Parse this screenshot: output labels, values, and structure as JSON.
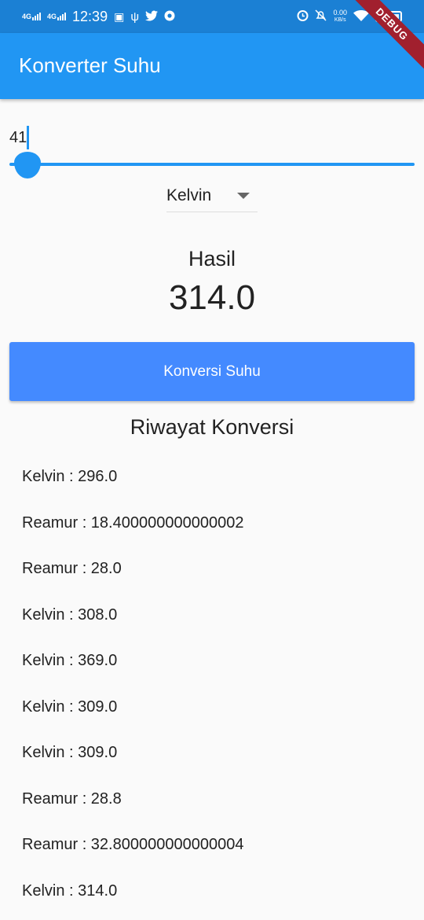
{
  "status_bar": {
    "network": "4G",
    "network2": "4G",
    "time": "12:39",
    "speed_value": "0.00",
    "speed_unit": "KB/s"
  },
  "app_bar": {
    "title": "Konverter Suhu",
    "debug_banner": "DEBUG"
  },
  "slider": {
    "value_label": "41",
    "value": 41,
    "level": 0.045
  },
  "dropdown": {
    "selected": "Kelvin"
  },
  "result": {
    "label": "Hasil",
    "value": "314.0"
  },
  "convert_button_label": "Konversi Suhu",
  "history": {
    "title": "Riwayat Konversi",
    "items": [
      "Kelvin : 296.0",
      "Reamur : 18.400000000000002",
      "Reamur : 28.0",
      "Kelvin : 308.0",
      "Kelvin : 369.0",
      "Kelvin : 309.0",
      "Kelvin : 309.0",
      "Reamur : 28.8",
      "Reamur : 32.800000000000004",
      "Kelvin : 314.0"
    ]
  },
  "colors": {
    "status_bar": "#1b80d4",
    "app_bar": "#2196f3",
    "button": "#448aff",
    "debug": "#a1202e"
  },
  "icons": [
    "signal-icon",
    "usb-icon",
    "twitter-icon",
    "chrome-icon",
    "alarm-icon",
    "mute-icon",
    "wifi-icon",
    "battery-icon"
  ]
}
